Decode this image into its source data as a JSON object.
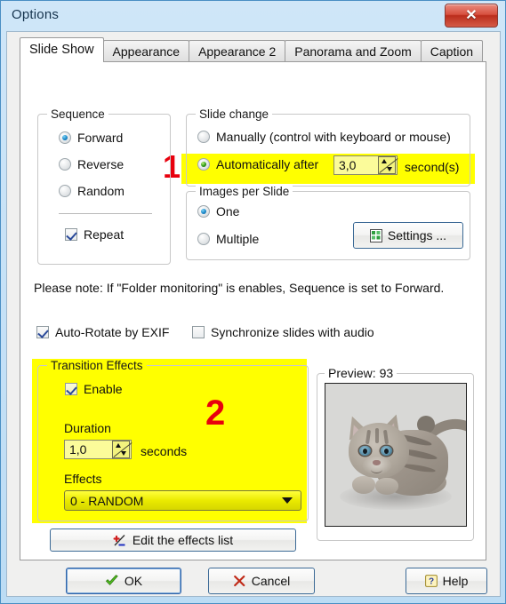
{
  "window": {
    "title": "Options",
    "close_label": "✕"
  },
  "tabs": [
    {
      "label": "Slide Show",
      "active": true
    },
    {
      "label": "Appearance",
      "active": false
    },
    {
      "label": "Appearance 2",
      "active": false
    },
    {
      "label": "Panorama and Zoom",
      "active": false
    },
    {
      "label": "Caption",
      "active": false
    }
  ],
  "sequence": {
    "legend": "Sequence",
    "options": [
      {
        "label": "Forward",
        "checked": true
      },
      {
        "label": "Reverse",
        "checked": false
      },
      {
        "label": "Random",
        "checked": false
      }
    ],
    "repeat": {
      "label": "Repeat",
      "checked": true
    }
  },
  "slide_change": {
    "legend": "Slide change",
    "manual": {
      "label": "Manually (control with keyboard or mouse)",
      "checked": false
    },
    "auto": {
      "label": "Automatically after",
      "checked": true
    },
    "interval_value": "3,0",
    "interval_unit": "second(s)",
    "highlight_color": "#ffff00",
    "marker": "1",
    "marker_color": "#e8000d"
  },
  "images_per_slide": {
    "legend": "Images per Slide",
    "options": [
      {
        "label": "One",
        "checked": true
      },
      {
        "label": "Multiple",
        "checked": false
      }
    ],
    "settings_button": "Settings ..."
  },
  "note": "Please note: If \"Folder monitoring\" is enables, Sequence is set to Forward.",
  "checkboxes": [
    {
      "label": "Auto-Rotate by EXIF",
      "checked": true
    },
    {
      "label": "Synchronize slides with audio",
      "checked": false
    }
  ],
  "transition_effects": {
    "legend": "Transition Effects",
    "enable": {
      "label": "Enable",
      "checked": true
    },
    "duration_label": "Duration",
    "duration_value": "1,0",
    "duration_unit": "seconds",
    "effects_label": "Effects",
    "effects_selected": "0 - RANDOM",
    "edit_button": "Edit the effects list",
    "highlight_color": "#ffff00",
    "marker": "2",
    "marker_color": "#e8000d"
  },
  "preview": {
    "legend": "Preview: 93"
  },
  "footer": {
    "ok": "OK",
    "cancel": "Cancel",
    "help": "Help"
  }
}
